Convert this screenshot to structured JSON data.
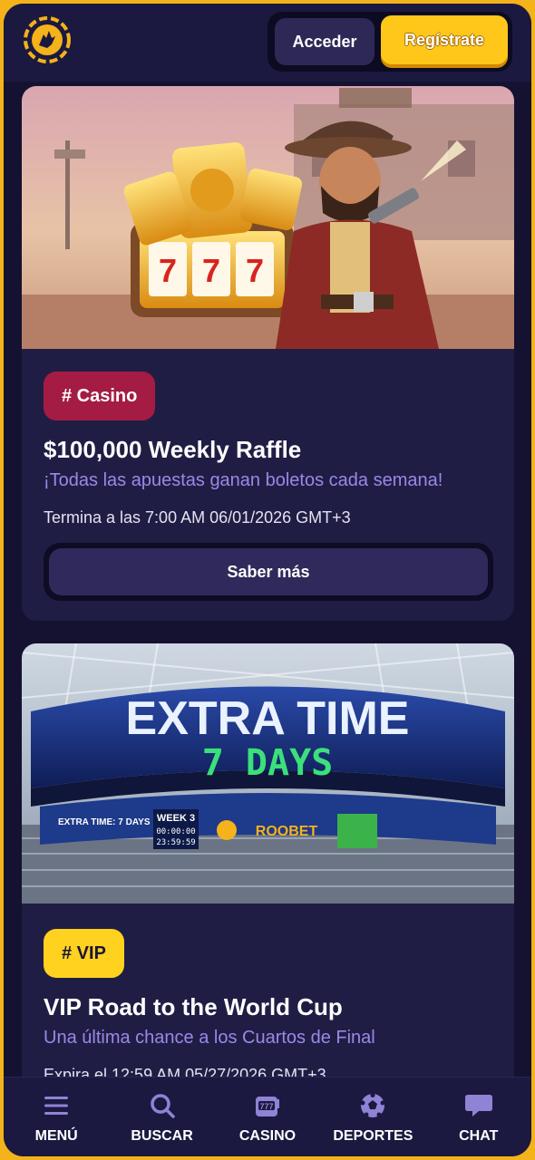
{
  "header": {
    "logo_icon": "roobet-kangaroo-logo-icon",
    "login_label": "Acceder",
    "register_label": "Regístrate"
  },
  "promotions": [
    {
      "tag": "# Casino",
      "tag_color": "#a41c43",
      "banner": "cowboy-slots-banner",
      "title": "$100,000 Weekly Raffle",
      "subtitle": "¡Todas las apuestas ganan boletos cada semana!",
      "date": "Termina a las 7:00 AM 06/01/2026 GMT+3",
      "button_label": "Saber más"
    },
    {
      "tag": "# VIP",
      "tag_color": "#ffd21f",
      "banner": "stadium-extra-time-banner",
      "banner_text": {
        "headline": "EXTRA TIME",
        "countdown": "7 DAYS",
        "week": "WEEK 3",
        "timer_1": "00:00:00",
        "timer_2": "23:59:59",
        "brand": "ROOBET",
        "ticker": "EXTRA TIME: 7 DAYS"
      },
      "title": "VIP Road to the World Cup",
      "subtitle": "Una última chance a los Cuartos de Final",
      "date": "Expira el 12:59 AM 05/27/2026 GMT+3"
    }
  ],
  "bottom_nav": [
    {
      "label": "MENÚ",
      "icon": "hamburger-menu-icon"
    },
    {
      "label": "BUSCAR",
      "icon": "search-icon"
    },
    {
      "label": "CASINO",
      "icon": "slot-machine-icon"
    },
    {
      "label": "DEPORTES",
      "icon": "soccer-ball-icon"
    },
    {
      "label": "CHAT",
      "icon": "chat-bubble-icon"
    }
  ],
  "colors": {
    "accent": "#ffc71a",
    "background": "#141230",
    "card": "#201d45",
    "subtitle": "#9b88e6",
    "border": "#f4b21b"
  }
}
